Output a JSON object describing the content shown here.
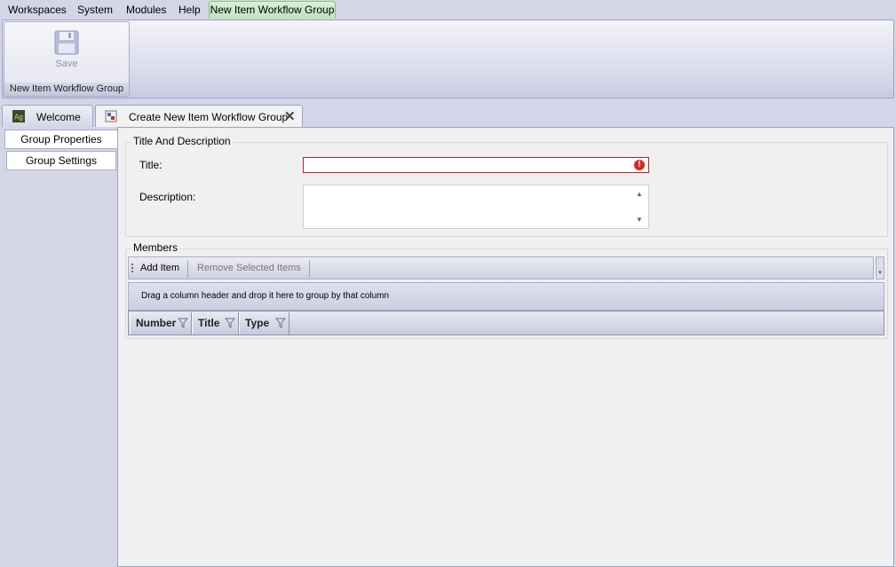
{
  "menu": {
    "items": [
      "Workspaces",
      "System",
      "Modules",
      "Help"
    ],
    "context_tab": "New Item Workflow Group"
  },
  "ribbon": {
    "save_label": "Save",
    "group_label": "New Item Workflow Group"
  },
  "tabs": [
    {
      "label": "Welcome",
      "icon": "app-logo-icon"
    },
    {
      "label": "Create New Item Workflow Group",
      "icon": "workflow-group-icon",
      "close": "✕"
    }
  ],
  "leftnav": {
    "items": [
      "Group Properties",
      "Group Settings"
    ]
  },
  "form": {
    "section_title": "Title And Description",
    "title_label": "Title:",
    "title_value": "",
    "description_label": "Description:",
    "description_value": "",
    "error_glyph": "!"
  },
  "members": {
    "section_title": "Members",
    "add_label": "Add Item",
    "remove_label": "Remove Selected Items",
    "group_hint": "Drag a column header and drop it here to group by that column",
    "columns": [
      "Number",
      "Title",
      "Type"
    ]
  },
  "colors": {
    "accent_green": "#bfe3bb",
    "error_red": "#c0202a",
    "chrome": "#d4d6e8"
  }
}
